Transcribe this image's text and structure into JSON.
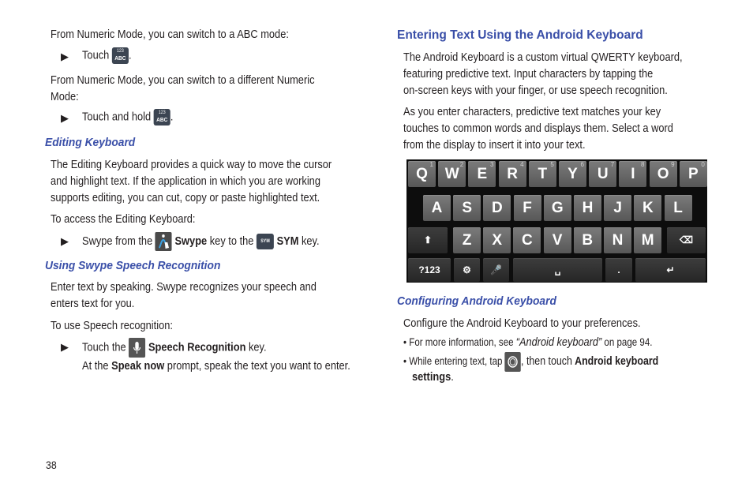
{
  "left_column": {
    "p1": "From Numeric Mode, you can switch to a ABC mode:",
    "step1_prefix": "Touch",
    "step1_suffix": ".",
    "p2_line1": "From Numeric Mode, you can switch to a different Numeric",
    "p2_line2": "Mode:",
    "step2_prefix": "Touch and hold",
    "step2_suffix": ".",
    "abc_key": {
      "top": "123",
      "bottom": "ABC"
    },
    "editing": {
      "heading": "Editing Keyboard",
      "p1_line1": "The Editing Keyboard provides a quick way to move the cursor",
      "p1_line2": "and highlight text. If the application in which you are working",
      "p1_line3": "supports editing, you can cut, copy or paste highlighted text.",
      "p2": "To access the Editing Keyboard:",
      "step_prefix": "Swype from the",
      "step_bold1": "Swype",
      "step_mid": "key to the",
      "sym_key": "SYM",
      "step_bold2": "SYM",
      "step_suffix": "key."
    },
    "speech": {
      "heading": "Using Swype Speech Recognition",
      "p1_line1": "Enter text by speaking. Swype recognizes your speech and",
      "p1_line2": "enters text for you.",
      "p2": "To use Speech recognition:",
      "step_prefix": "Touch the",
      "step_bold": "Speech Recognition",
      "step_suffix": "key.",
      "sub_prefix": "At the",
      "sub_bold": "Speak now",
      "sub_suffix": "prompt, speak the text you want to enter."
    }
  },
  "right_column": {
    "heading": "Entering Text Using the Android Keyboard",
    "p1_line1": "The Android Keyboard is a custom virtual QWERTY keyboard,",
    "p1_line2": "featuring predictive text. Input characters by tapping the",
    "p1_line3": "on-screen keys with your finger, or use speech recognition.",
    "p2_line1": "As you enter characters, predictive text matches your key",
    "p2_line2": "touches to common words and displays them. Select a word",
    "p2_line3": "from the display to insert it into your text.",
    "keyboard": {
      "row1": [
        {
          "label": "Q",
          "num": "1"
        },
        {
          "label": "W",
          "num": "2"
        },
        {
          "label": "E",
          "num": "3"
        },
        {
          "label": "R",
          "num": "4"
        },
        {
          "label": "T",
          "num": "5"
        },
        {
          "label": "Y",
          "num": "6"
        },
        {
          "label": "U",
          "num": "7"
        },
        {
          "label": "I",
          "num": "8"
        },
        {
          "label": "O",
          "num": "9"
        },
        {
          "label": "P",
          "num": "0"
        }
      ],
      "row2": [
        "A",
        "S",
        "D",
        "F",
        "G",
        "H",
        "J",
        "K",
        "L"
      ],
      "row3": [
        "Z",
        "X",
        "C",
        "V",
        "B",
        "N",
        "M"
      ],
      "shift_icon": "⬆",
      "backspace_icon": "⌫",
      "symbols_key": "?123",
      "settings_icon": "⚙",
      "mic_icon": "🎤",
      "space_icon": "␣",
      "period_key": ".",
      "enter_icon": "↵"
    },
    "config": {
      "heading": "Configuring Android Keyboard",
      "p1": "Configure the Android Keyboard to your preferences.",
      "bullet1_prefix": "For more information, see",
      "bullet1_ref": "“Android keyboard”",
      "bullet1_suffix": "on page 94.",
      "bullet2_prefix": "While entering text, tap",
      "bullet2_mid": ", then touch",
      "bullet2_bold1": "Android keyboard",
      "bullet2_bold2": "settings",
      "bullet2_end": "."
    }
  },
  "page_number": "38"
}
